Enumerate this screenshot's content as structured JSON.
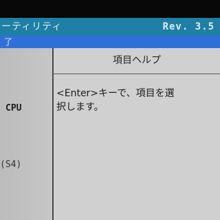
{
  "title_bar": {
    "title": "ーティリティ",
    "revision": "Rev. 3.5"
  },
  "tab_bar": {
    "label": "了"
  },
  "left_pane": {
    "items": [
      {
        "label": "CPU"
      },
      {
        "label": "(S4)"
      }
    ]
  },
  "help_pane": {
    "title": "項目ヘルプ",
    "text": "<Enter>キーで、項目を選\n択します。"
  },
  "colors": {
    "title_bar": "#1f7fa5",
    "tab_bar": "#2f6fd8",
    "panel": "#c8c8c8"
  }
}
